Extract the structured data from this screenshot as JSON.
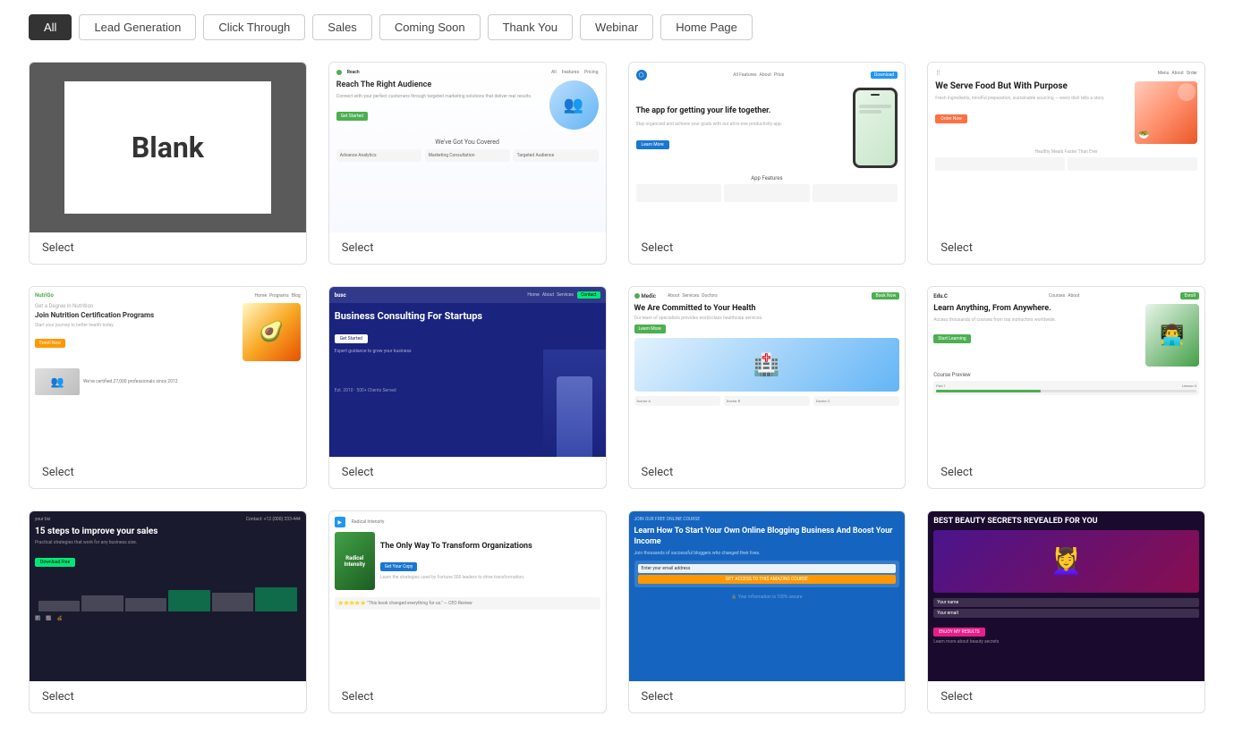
{
  "filters": {
    "all": "All",
    "lead_generation": "Lead Generation",
    "click_through": "Click Through",
    "sales": "Sales",
    "coming_soon": "Coming Soon",
    "thank_you": "Thank You",
    "webinar": "Webinar",
    "home_page": "Home Page"
  },
  "templates": [
    {
      "id": "blank",
      "label": "Select",
      "type": "blank"
    },
    {
      "id": "reach-right-audience",
      "label": "Select",
      "type": "reach"
    },
    {
      "id": "app-life-together",
      "label": "Select",
      "type": "app"
    },
    {
      "id": "food-purpose",
      "label": "Select",
      "type": "food"
    },
    {
      "id": "nutrition",
      "label": "Select",
      "type": "nutrition"
    },
    {
      "id": "business-consulting",
      "label": "Select",
      "type": "business"
    },
    {
      "id": "health",
      "label": "Select",
      "type": "health"
    },
    {
      "id": "education",
      "label": "Select",
      "type": "education"
    },
    {
      "id": "sales-improve",
      "label": "Select",
      "type": "sales"
    },
    {
      "id": "transform-org",
      "label": "Select",
      "type": "transform"
    },
    {
      "id": "blogging",
      "label": "Select",
      "type": "blogging"
    },
    {
      "id": "beauty",
      "label": "Select",
      "type": "beauty"
    }
  ]
}
